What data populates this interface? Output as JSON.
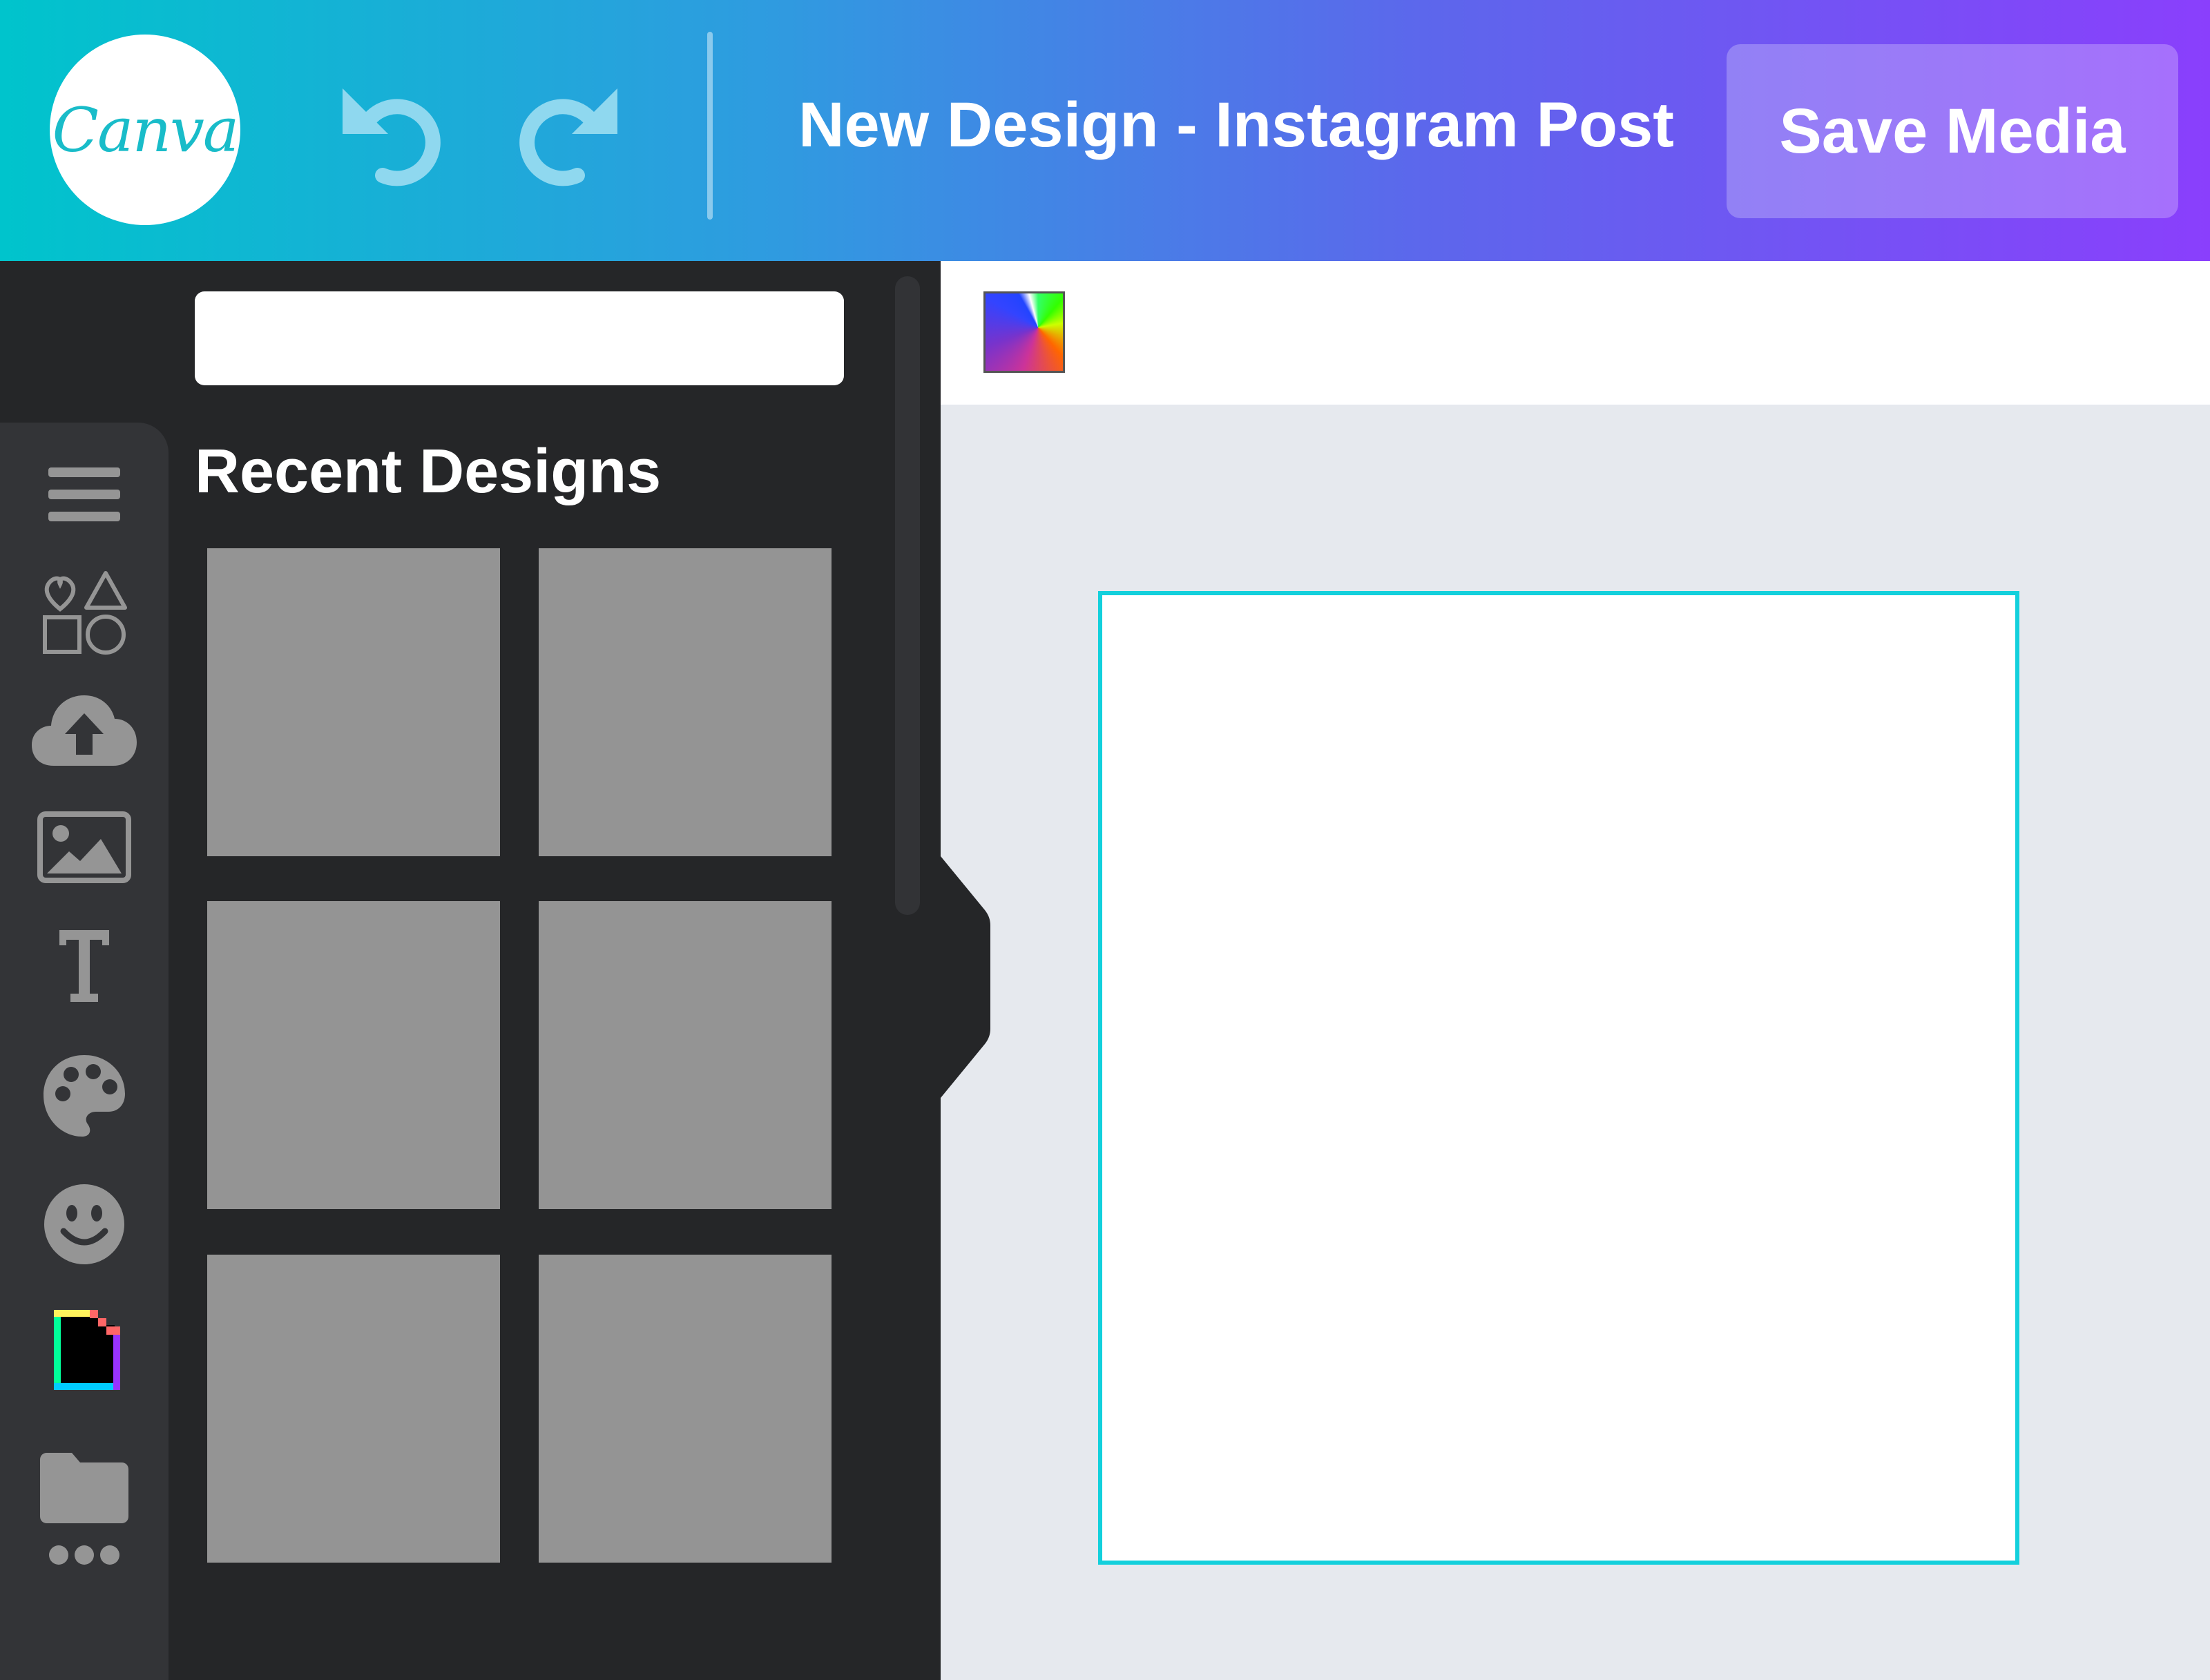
{
  "header": {
    "logo_text": "Canva",
    "title": "New Design - Instagram Post",
    "save_label": "Save Media",
    "undo_icon": "undo-icon",
    "redo_icon": "redo-icon",
    "gradient_colors": [
      "#00c4cc",
      "#8a3ffc"
    ]
  },
  "side_panel": {
    "search": {
      "value": "",
      "placeholder": ""
    },
    "section_title": "Recent Designs",
    "recent_designs": [
      {
        "name": "recent-design-1"
      },
      {
        "name": "recent-design-2"
      },
      {
        "name": "recent-design-3"
      },
      {
        "name": "recent-design-4"
      },
      {
        "name": "recent-design-5"
      },
      {
        "name": "recent-design-6"
      }
    ],
    "thumbnail_color": "#949494"
  },
  "rail": {
    "items": [
      {
        "icon": "menu-icon"
      },
      {
        "icon": "elements-icon"
      },
      {
        "icon": "upload-cloud-icon"
      },
      {
        "icon": "photos-icon"
      },
      {
        "icon": "text-icon"
      },
      {
        "icon": "palette-icon"
      },
      {
        "icon": "smiley-icon"
      },
      {
        "icon": "giphy-icon"
      },
      {
        "icon": "folder-icon"
      },
      {
        "icon": "more-icon"
      }
    ],
    "icon_color": "#959595"
  },
  "toolbar": {
    "color_picker_icon": "color-swatch-icon"
  },
  "canvas": {
    "page_border_color": "#13d0dc",
    "workspace_color": "#e6e9ee"
  }
}
